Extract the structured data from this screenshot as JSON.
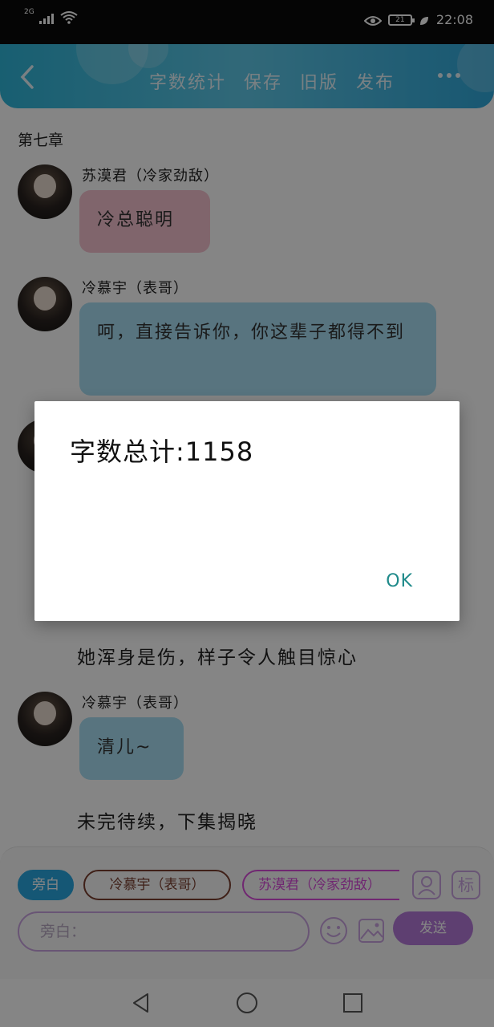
{
  "status_bar": {
    "network": "2G",
    "battery": "21",
    "time": "22:08"
  },
  "header": {
    "actions": [
      "字数统计",
      "保存",
      "旧版",
      "发布"
    ]
  },
  "chapter_title": "第七章",
  "messages": [
    {
      "sender": "苏漠君（冷家劲敌）",
      "text": "冷总聪明",
      "bubble": "pink"
    },
    {
      "sender": "冷慕宇（表哥）",
      "text": "呵，直接告诉你，你这辈子都得不到",
      "bubble": "blue"
    }
  ],
  "narration_1": "她浑身是伤，样子令人触目惊心",
  "message_3": {
    "sender": "冷慕宇（表哥）",
    "text": "清儿~",
    "bubble": "blue"
  },
  "narration_2": "未完待续，下集揭晓",
  "bottom": {
    "chips": [
      "旁白",
      "冷慕宇（表哥）",
      "苏漠君（冷家劲敌）"
    ],
    "icon_label": "标",
    "input_placeholder": "旁白：",
    "send_label": "发送"
  },
  "dialog": {
    "message": "字数总计:1158",
    "ok_label": "OK"
  },
  "colors": {
    "header": "#2fb6d9",
    "pink_bubble": "#f6c2cf",
    "blue_bubble": "#a9dff3",
    "send_button": "#b57ad8",
    "ok_text": "#1f8a8a"
  }
}
